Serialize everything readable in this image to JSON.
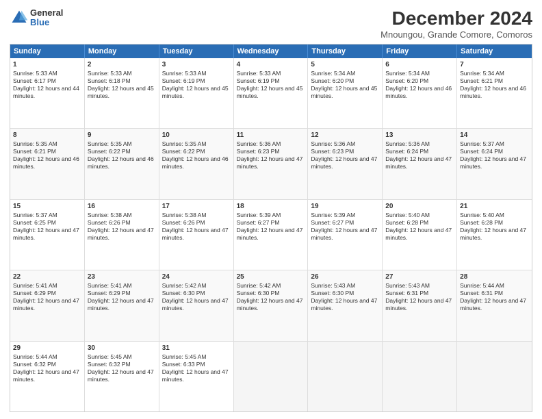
{
  "logo": {
    "general": "General",
    "blue": "Blue"
  },
  "title": {
    "main": "December 2024",
    "sub": "Mnoungou, Grande Comore, Comoros"
  },
  "calendar": {
    "headers": [
      "Sunday",
      "Monday",
      "Tuesday",
      "Wednesday",
      "Thursday",
      "Friday",
      "Saturday"
    ],
    "weeks": [
      [
        {
          "day": "",
          "empty": true
        },
        {
          "day": "",
          "empty": true
        },
        {
          "day": "",
          "empty": true
        },
        {
          "day": "",
          "empty": true
        },
        {
          "day": "",
          "empty": true
        },
        {
          "day": "",
          "empty": true
        },
        {
          "day": "",
          "empty": true
        }
      ],
      [
        {
          "day": "1",
          "sunrise": "5:33 AM",
          "sunset": "6:17 PM",
          "daylight": "12 hours and 44 minutes."
        },
        {
          "day": "2",
          "sunrise": "5:33 AM",
          "sunset": "6:18 PM",
          "daylight": "12 hours and 45 minutes."
        },
        {
          "day": "3",
          "sunrise": "5:33 AM",
          "sunset": "6:19 PM",
          "daylight": "12 hours and 45 minutes."
        },
        {
          "day": "4",
          "sunrise": "5:33 AM",
          "sunset": "6:19 PM",
          "daylight": "12 hours and 45 minutes."
        },
        {
          "day": "5",
          "sunrise": "5:34 AM",
          "sunset": "6:20 PM",
          "daylight": "12 hours and 45 minutes."
        },
        {
          "day": "6",
          "sunrise": "5:34 AM",
          "sunset": "6:20 PM",
          "daylight": "12 hours and 46 minutes."
        },
        {
          "day": "7",
          "sunrise": "5:34 AM",
          "sunset": "6:21 PM",
          "daylight": "12 hours and 46 minutes."
        }
      ],
      [
        {
          "day": "8",
          "sunrise": "5:35 AM",
          "sunset": "6:21 PM",
          "daylight": "12 hours and 46 minutes."
        },
        {
          "day": "9",
          "sunrise": "5:35 AM",
          "sunset": "6:22 PM",
          "daylight": "12 hours and 46 minutes."
        },
        {
          "day": "10",
          "sunrise": "5:35 AM",
          "sunset": "6:22 PM",
          "daylight": "12 hours and 46 minutes."
        },
        {
          "day": "11",
          "sunrise": "5:36 AM",
          "sunset": "6:23 PM",
          "daylight": "12 hours and 47 minutes."
        },
        {
          "day": "12",
          "sunrise": "5:36 AM",
          "sunset": "6:23 PM",
          "daylight": "12 hours and 47 minutes."
        },
        {
          "day": "13",
          "sunrise": "5:36 AM",
          "sunset": "6:24 PM",
          "daylight": "12 hours and 47 minutes."
        },
        {
          "day": "14",
          "sunrise": "5:37 AM",
          "sunset": "6:24 PM",
          "daylight": "12 hours and 47 minutes."
        }
      ],
      [
        {
          "day": "15",
          "sunrise": "5:37 AM",
          "sunset": "6:25 PM",
          "daylight": "12 hours and 47 minutes."
        },
        {
          "day": "16",
          "sunrise": "5:38 AM",
          "sunset": "6:26 PM",
          "daylight": "12 hours and 47 minutes."
        },
        {
          "day": "17",
          "sunrise": "5:38 AM",
          "sunset": "6:26 PM",
          "daylight": "12 hours and 47 minutes."
        },
        {
          "day": "18",
          "sunrise": "5:39 AM",
          "sunset": "6:27 PM",
          "daylight": "12 hours and 47 minutes."
        },
        {
          "day": "19",
          "sunrise": "5:39 AM",
          "sunset": "6:27 PM",
          "daylight": "12 hours and 47 minutes."
        },
        {
          "day": "20",
          "sunrise": "5:40 AM",
          "sunset": "6:28 PM",
          "daylight": "12 hours and 47 minutes."
        },
        {
          "day": "21",
          "sunrise": "5:40 AM",
          "sunset": "6:28 PM",
          "daylight": "12 hours and 47 minutes."
        }
      ],
      [
        {
          "day": "22",
          "sunrise": "5:41 AM",
          "sunset": "6:29 PM",
          "daylight": "12 hours and 47 minutes."
        },
        {
          "day": "23",
          "sunrise": "5:41 AM",
          "sunset": "6:29 PM",
          "daylight": "12 hours and 47 minutes."
        },
        {
          "day": "24",
          "sunrise": "5:42 AM",
          "sunset": "6:30 PM",
          "daylight": "12 hours and 47 minutes."
        },
        {
          "day": "25",
          "sunrise": "5:42 AM",
          "sunset": "6:30 PM",
          "daylight": "12 hours and 47 minutes."
        },
        {
          "day": "26",
          "sunrise": "5:43 AM",
          "sunset": "6:30 PM",
          "daylight": "12 hours and 47 minutes."
        },
        {
          "day": "27",
          "sunrise": "5:43 AM",
          "sunset": "6:31 PM",
          "daylight": "12 hours and 47 minutes."
        },
        {
          "day": "28",
          "sunrise": "5:44 AM",
          "sunset": "6:31 PM",
          "daylight": "12 hours and 47 minutes."
        }
      ],
      [
        {
          "day": "29",
          "sunrise": "5:44 AM",
          "sunset": "6:32 PM",
          "daylight": "12 hours and 47 minutes."
        },
        {
          "day": "30",
          "sunrise": "5:45 AM",
          "sunset": "6:32 PM",
          "daylight": "12 hours and 47 minutes."
        },
        {
          "day": "31",
          "sunrise": "5:45 AM",
          "sunset": "6:33 PM",
          "daylight": "12 hours and 47 minutes."
        },
        {
          "day": "",
          "empty": true
        },
        {
          "day": "",
          "empty": true
        },
        {
          "day": "",
          "empty": true
        },
        {
          "day": "",
          "empty": true
        }
      ]
    ]
  }
}
